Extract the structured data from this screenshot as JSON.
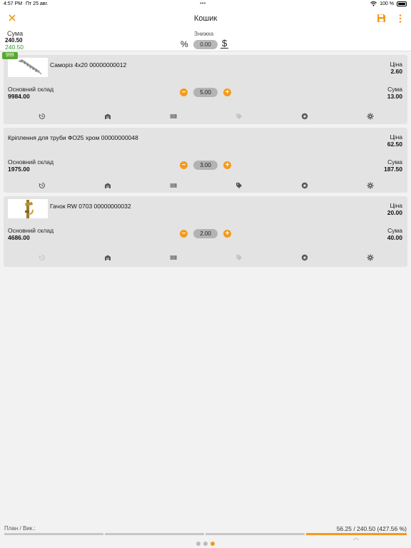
{
  "status_bar": {
    "time": "4:57 PM",
    "date": "Пт 25 авг.",
    "dots": "•••",
    "battery": "100 %"
  },
  "nav": {
    "title": "Кошик",
    "close_icon": "close-icon",
    "save_icon": "save-icon",
    "more_icon": "more-vertical-icon"
  },
  "summary": {
    "sum_label": "Сума",
    "sum_value": "240.50",
    "sum_value_green": "240.50",
    "discount_label": "Знижка",
    "percent_symbol": "%",
    "discount_value": "0.00",
    "dollar_symbol": "$"
  },
  "badge": "999",
  "cart_items": [
    {
      "name": "Саморіз 4х20 00000000012",
      "price_label": "Ціна",
      "price": "2.60",
      "warehouse_label": "Основний склад",
      "warehouse_stock": "9984.00",
      "quantity": "5.00",
      "sum_label": "Сума",
      "sum": "13.00",
      "has_image": true,
      "image": "screw-image"
    },
    {
      "name": "Кріплення для труби ФО25 хром 00000000048",
      "price_label": "Ціна",
      "price": "62.50",
      "warehouse_label": "Основний склад",
      "warehouse_stock": "1975.00",
      "quantity": "3.00",
      "sum_label": "Сума",
      "sum": "187.50",
      "has_image": false
    },
    {
      "name": "Гачок RW 0703 00000000032",
      "price_label": "Ціна",
      "price": "20.00",
      "warehouse_label": "Основний склад",
      "warehouse_stock": "4686.00",
      "quantity": "2.00",
      "sum_label": "Сума",
      "sum": "40.00",
      "has_image": true,
      "image": "hook-image"
    }
  ],
  "action_icons": [
    "history-icon",
    "warehouse-icon",
    "barcode-icon",
    "tag-icon",
    "star-icon",
    "gear-icon"
  ],
  "footer": {
    "plan_label": "План / Вик.:",
    "plan_value": "56.25 / 240.50 (427.56 %)",
    "page_count": 3,
    "active_page": 3
  },
  "colors": {
    "accent": "#f39a1e",
    "green": "#5aa832",
    "card_bg": "#e3e3e3"
  }
}
